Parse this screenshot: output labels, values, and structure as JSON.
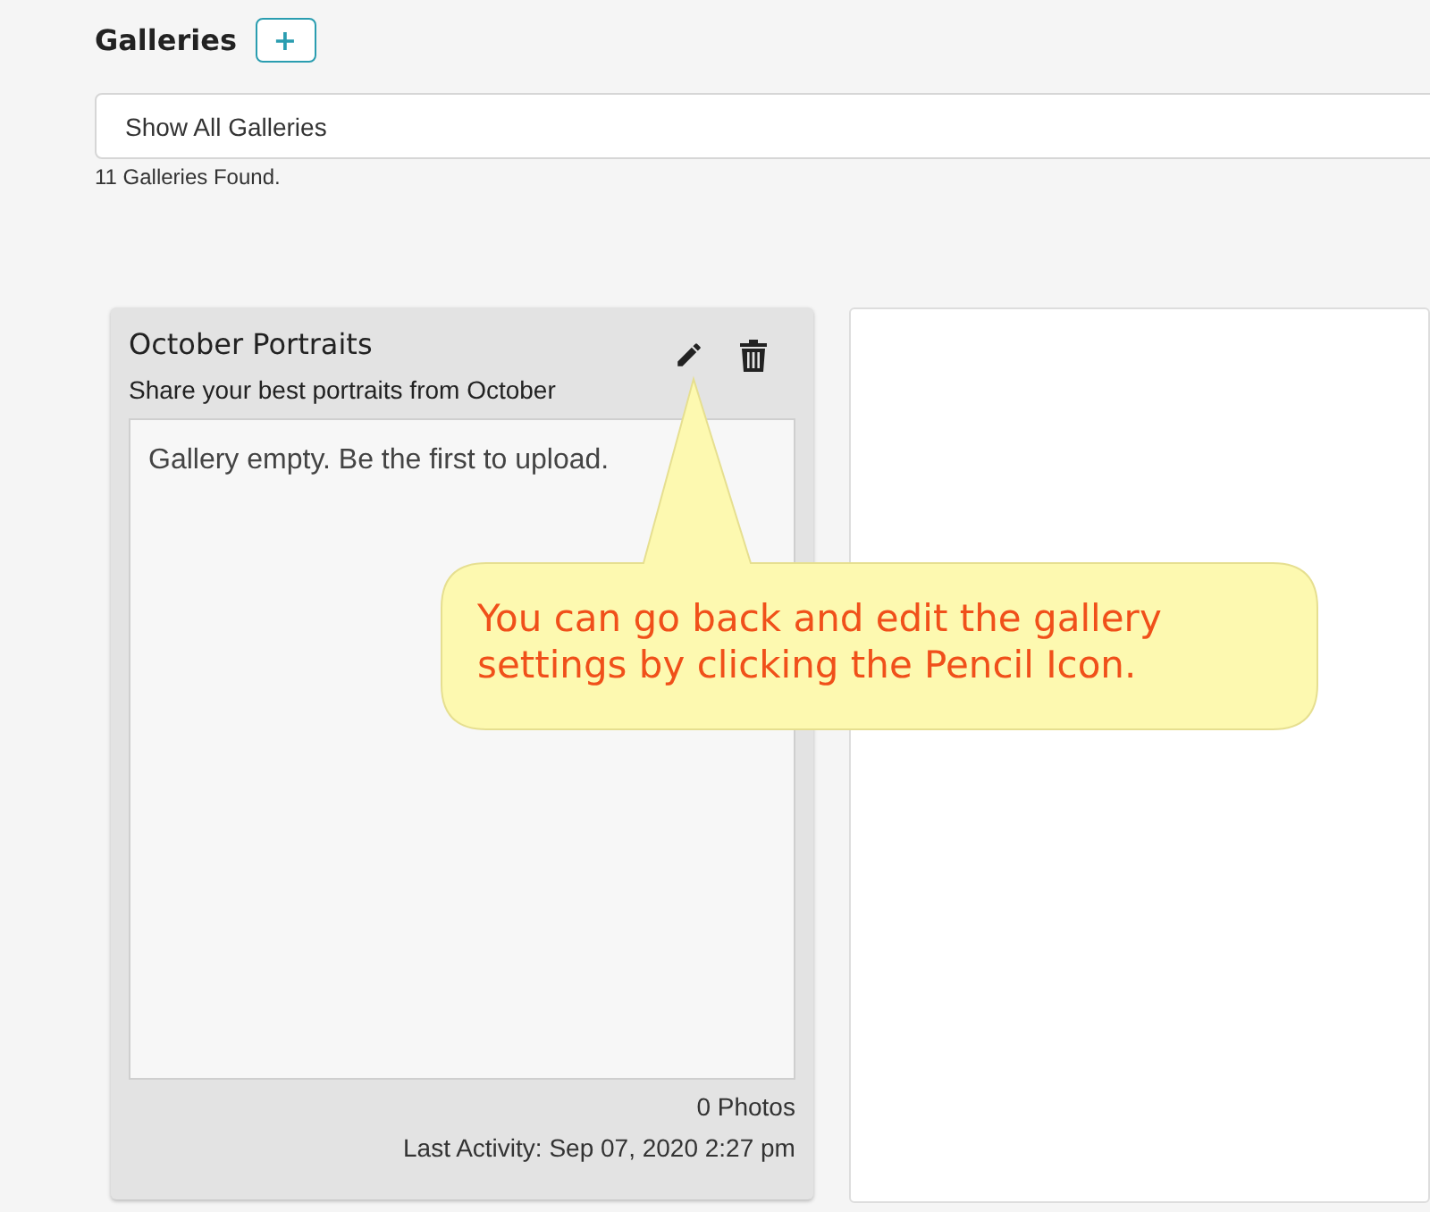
{
  "header": {
    "title": "Galleries",
    "add_button": "+"
  },
  "filter": {
    "value": "Show All Galleries"
  },
  "result_count": "11 Galleries Found.",
  "galleries": [
    {
      "title": "October Portraits",
      "description": "Share your best portraits from October",
      "empty_message": "Gallery empty. Be the first to upload.",
      "photo_count": "0 Photos",
      "last_activity": "Last Activity: Sep 07, 2020 2:27 pm"
    }
  ],
  "callout": {
    "text": "You can go back and edit the gallery settings by clicking the Pencil Icon."
  }
}
